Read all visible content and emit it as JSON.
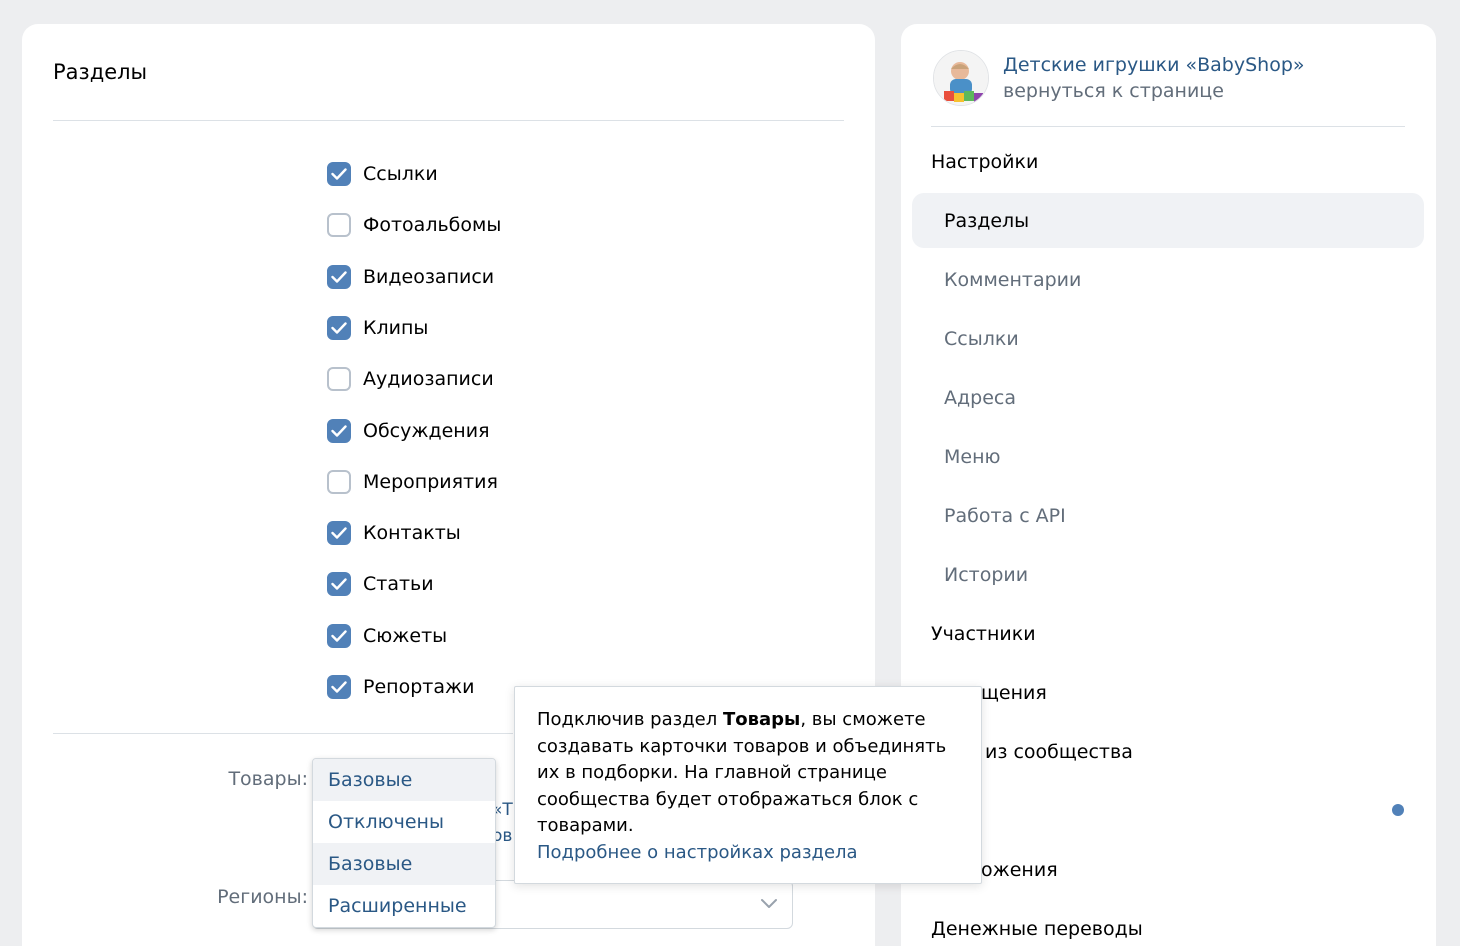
{
  "main": {
    "title": "Разделы",
    "sections": [
      {
        "label": "Ссылки",
        "checked": true
      },
      {
        "label": "Фотоальбомы",
        "checked": false
      },
      {
        "label": "Видеозаписи",
        "checked": true
      },
      {
        "label": "Клипы",
        "checked": true
      },
      {
        "label": "Аудиозаписи",
        "checked": false
      },
      {
        "label": "Обсуждения",
        "checked": true
      },
      {
        "label": "Мероприятия",
        "checked": false
      },
      {
        "label": "Контакты",
        "checked": true
      },
      {
        "label": "Статьи",
        "checked": true
      },
      {
        "label": "Сюжеты",
        "checked": true
      },
      {
        "label": "Репортажи",
        "checked": true
      }
    ],
    "goods_label": "Товары:",
    "regions_label": "Регионы:",
    "goods_selected": "Базовые",
    "goods_options": [
      "Отключены",
      "Базовые",
      "Расширенные"
    ],
    "obscured_text_1": "«Т",
    "obscured_text_2": "ов"
  },
  "tooltip": {
    "text_before": "Подключив раздел ",
    "text_bold": "Товары",
    "text_after": ", вы сможете создавать карточки товаров и объединять их в подборки. На главной странице сообщества будет отображаться блок с товарами.",
    "link": "Подробнее о настройках раздела"
  },
  "sidebar": {
    "community_name": "Детские игрушки «BabyShop»",
    "back_link": "вернуться к странице",
    "settings_heading": "Настройки",
    "items": [
      {
        "label": "Разделы",
        "active": true
      },
      {
        "label": "Комментарии",
        "active": false
      },
      {
        "label": "Ссылки",
        "active": false
      },
      {
        "label": "Адреса",
        "active": false
      },
      {
        "label": "Меню",
        "active": false
      },
      {
        "label": "Работа с API",
        "active": false
      },
      {
        "label": "Истории",
        "active": false
      }
    ],
    "members_heading": "Участники",
    "partial_1": "щения",
    "partial_2": "из сообщества",
    "partial_3": "ожения",
    "money_transfers": "Денежные переводы"
  },
  "colors": {
    "accent": "#5181b8",
    "link": "#2a5885",
    "background": "#edeef0"
  }
}
